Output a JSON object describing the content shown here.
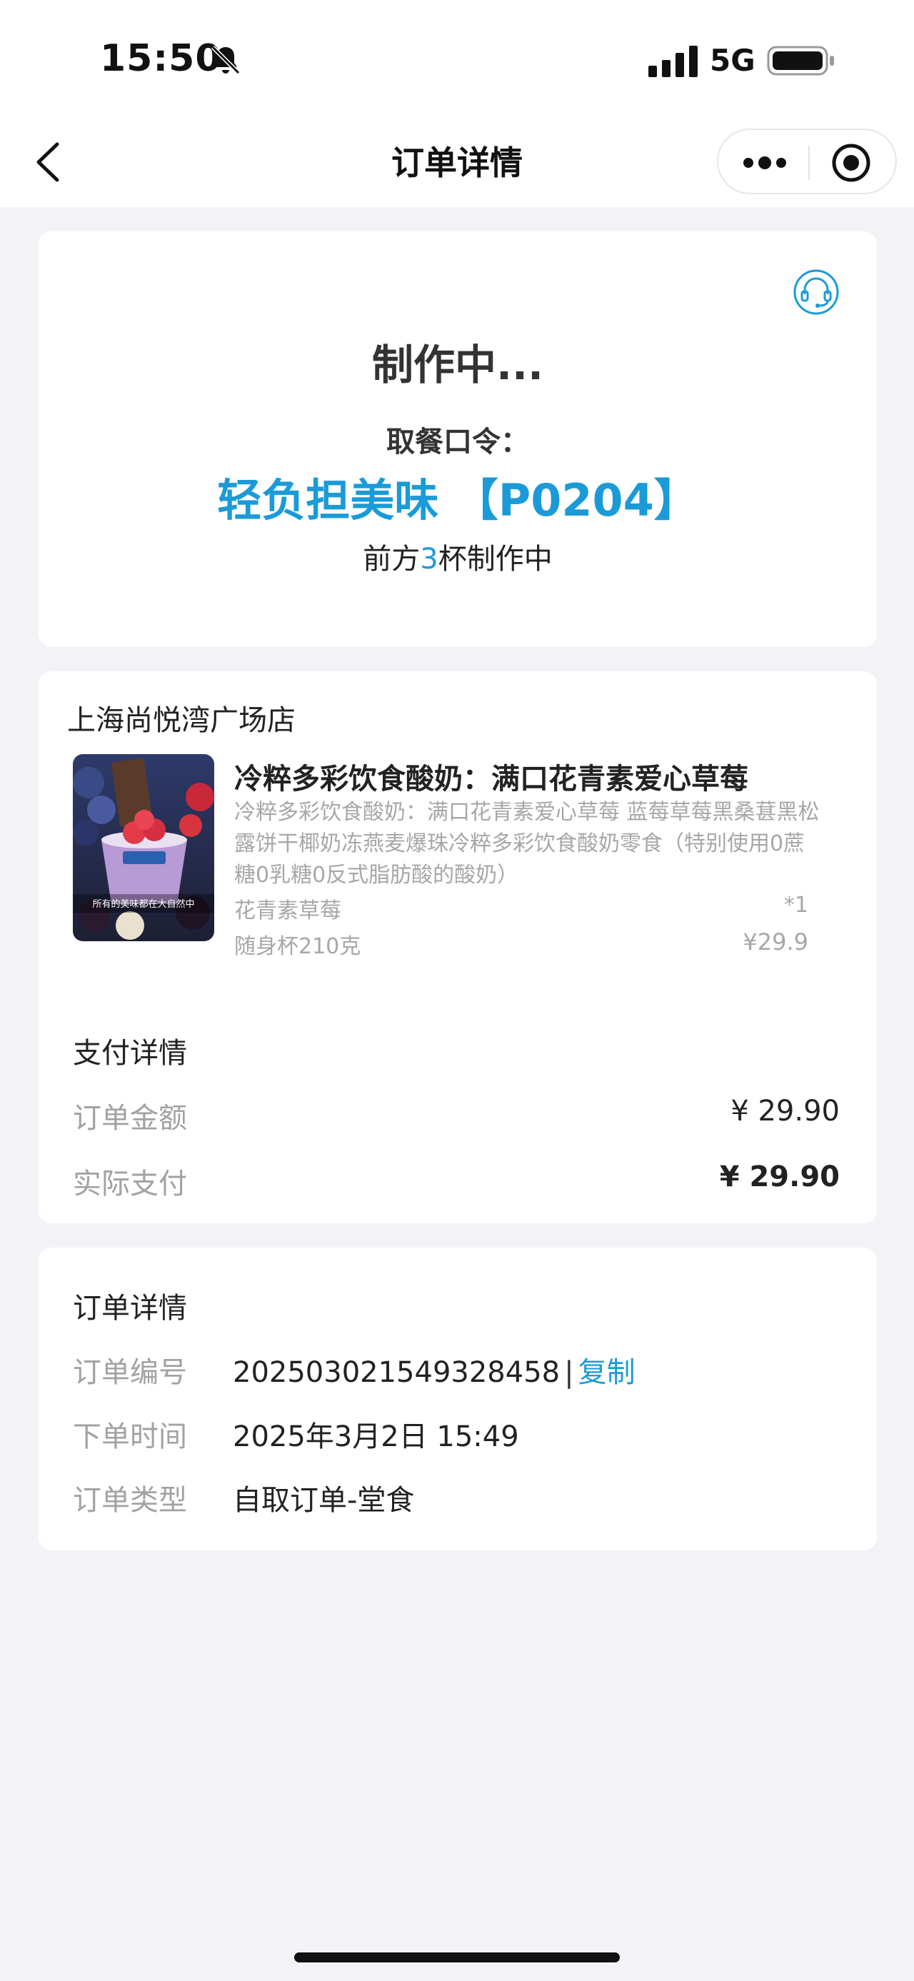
{
  "status_bar": {
    "time": "15:50",
    "network": "5G"
  },
  "nav": {
    "title": "订单详情"
  },
  "order_status": {
    "status": "制作中...",
    "pickup_label": "取餐口令：",
    "pickup_code": "轻负担美味 【P0204】",
    "queue_prefix": "前方",
    "queue_count": "3",
    "queue_suffix": "杯制作中"
  },
  "store": {
    "name": "上海尚悦湾广场店"
  },
  "product": {
    "image_caption": "所有的美味都在大自然中",
    "title": "冷粹多彩饮食酸奶：满口花青素爱心草莓",
    "description": "冷粹多彩饮食酸奶：满口花青素爱心草莓 蓝莓草莓黑桑葚黑松露饼干椰奶冻燕麦爆珠冷粹多彩饮食酸奶零食（特别使用0蔗糖0乳糖0反式脂肪酸的酸奶）",
    "spec1": "花青素草莓",
    "spec2": "随身杯210克",
    "quantity": "*1",
    "price": "¥29.9"
  },
  "payment": {
    "title": "支付详情",
    "order_amount_label": "订单金额",
    "order_amount": "¥ 29.90",
    "actual_paid_label": "实际支付",
    "actual_paid": "¥ 29.90"
  },
  "order_info": {
    "title": "订单详情",
    "number_label": "订单编号",
    "number": "2025030215493284​58",
    "separator": "|",
    "copy_label": "复制",
    "time_label": "下单时间",
    "time": "2025年3月2日 15:49",
    "type_label": "订单类型",
    "type": "自取订单-堂食"
  },
  "colors": {
    "accent": "#1a9bd7",
    "background": "#f3f3f7",
    "card": "#ffffff",
    "muted": "#a7a7a7"
  }
}
